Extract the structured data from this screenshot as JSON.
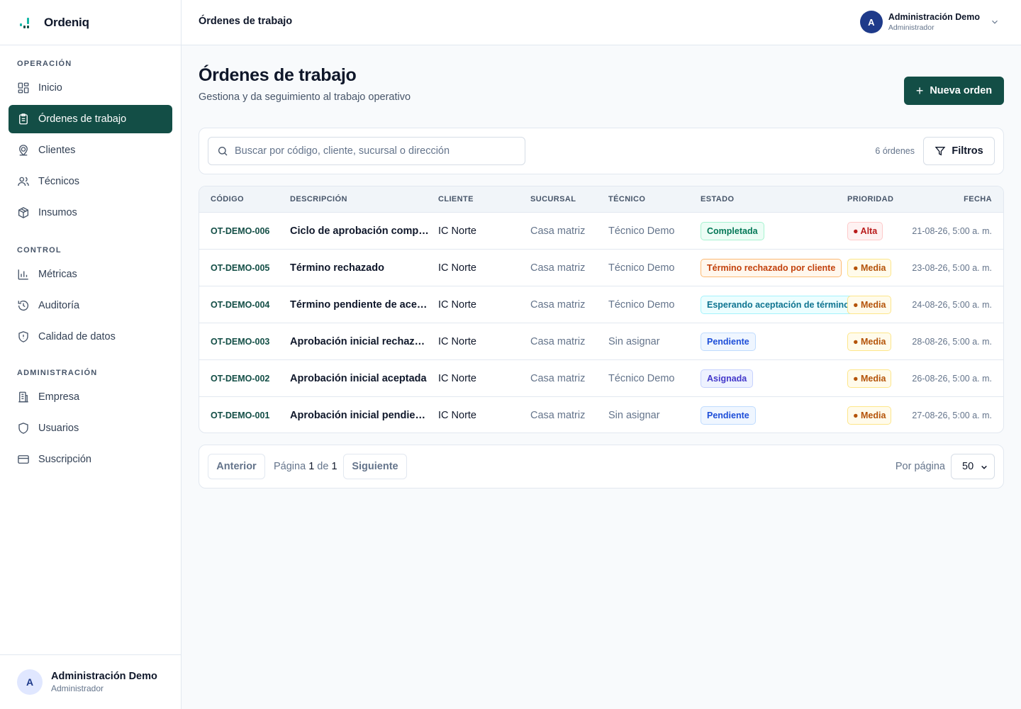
{
  "app": {
    "name": "Ordeniq",
    "accent": "#134e46"
  },
  "sidebar": {
    "sections": [
      {
        "title": "OPERACIÓN",
        "items": [
          {
            "label": "Inicio",
            "icon": "dashboard-icon"
          },
          {
            "label": "Órdenes de trabajo",
            "icon": "clipboard-icon",
            "active": true
          },
          {
            "label": "Clientes",
            "icon": "map-pin-icon"
          },
          {
            "label": "Técnicos",
            "icon": "users-icon"
          },
          {
            "label": "Insumos",
            "icon": "package-icon"
          }
        ]
      },
      {
        "title": "CONTROL",
        "items": [
          {
            "label": "Métricas",
            "icon": "bar-chart-icon"
          },
          {
            "label": "Auditoría",
            "icon": "history-icon"
          },
          {
            "label": "Calidad de datos",
            "icon": "shield-alert-icon"
          }
        ]
      },
      {
        "title": "ADMINISTRACIÓN",
        "items": [
          {
            "label": "Empresa",
            "icon": "building-icon"
          },
          {
            "label": "Usuarios",
            "icon": "shield-icon"
          },
          {
            "label": "Suscripción",
            "icon": "credit-card-icon"
          }
        ]
      }
    ],
    "user": {
      "initial": "A",
      "name": "Administración Demo",
      "role": "Administrador"
    }
  },
  "topbar": {
    "title": "Órdenes de trabajo",
    "user": {
      "initial": "A",
      "name": "Administración Demo",
      "role": "Administrador"
    }
  },
  "page": {
    "title": "Órdenes de trabajo",
    "subtitle": "Gestiona y da seguimiento al trabajo operativo",
    "new_button": "Nueva orden",
    "new_button_icon": "plus-icon"
  },
  "filters": {
    "search_placeholder": "Buscar por código, cliente, sucursal o dirección",
    "count": "6 órdenes",
    "filter_button": "Filtros"
  },
  "table": {
    "columns": [
      "CÓDIGO",
      "DESCRIPCIÓN",
      "CLIENTE",
      "SUCURSAL",
      "TÉCNICO",
      "ESTADO",
      "PRIORIDAD",
      "FECHA"
    ],
    "rows": [
      {
        "code": "OT-DEMO-006",
        "description": "Ciclo de aprobación compl…",
        "client": "IC Norte",
        "branch": "Casa matriz",
        "tech": "Técnico Demo",
        "status": "Completada",
        "status_tone": "green",
        "priority": "● Alta",
        "priority_tone": "red",
        "date": "21-08-26, 5:00 a. m."
      },
      {
        "code": "OT-DEMO-005",
        "description": "Término rechazado",
        "client": "IC Norte",
        "branch": "Casa matriz",
        "tech": "Técnico Demo",
        "status": "Término rechazado por cliente",
        "status_tone": "orange",
        "priority": "● Media",
        "priority_tone": "amber",
        "date": "23-08-26, 5:00 a. m."
      },
      {
        "code": "OT-DEMO-004",
        "description": "Término pendiente de acep…",
        "client": "IC Norte",
        "branch": "Casa matriz",
        "tech": "Técnico Demo",
        "status": "Esperando aceptación de término",
        "status_tone": "cyan",
        "priority": "● Media",
        "priority_tone": "amber",
        "date": "24-08-26, 5:00 a. m."
      },
      {
        "code": "OT-DEMO-003",
        "description": "Aprobación inicial rechazada",
        "client": "IC Norte",
        "branch": "Casa matriz",
        "tech": "Sin asignar",
        "status": "Pendiente",
        "status_tone": "blue",
        "priority": "● Media",
        "priority_tone": "amber",
        "date": "28-08-26, 5:00 a. m."
      },
      {
        "code": "OT-DEMO-002",
        "description": "Aprobación inicial aceptada",
        "client": "IC Norte",
        "branch": "Casa matriz",
        "tech": "Técnico Demo",
        "status": "Asignada",
        "status_tone": "indigo",
        "priority": "● Media",
        "priority_tone": "amber",
        "date": "26-08-26, 5:00 a. m."
      },
      {
        "code": "OT-DEMO-001",
        "description": "Aprobación inicial pendiente",
        "client": "IC Norte",
        "branch": "Casa matriz",
        "tech": "Sin asignar",
        "status": "Pendiente",
        "status_tone": "blue",
        "priority": "● Media",
        "priority_tone": "amber",
        "date": "27-08-26, 5:00 a. m."
      }
    ]
  },
  "pagination": {
    "prev": "Anterior",
    "next": "Siguiente",
    "page_word": "Página",
    "page": "1",
    "of_word": "de",
    "total": "1",
    "per_page_label": "Por página",
    "per_page": "50"
  },
  "tones": {
    "green": {
      "bg": "#ecfdf5",
      "border": "#a7f3d0",
      "text": "#047857"
    },
    "orange": {
      "bg": "#fff7ed",
      "border": "#fdba74",
      "text": "#c2410c"
    },
    "cyan": {
      "bg": "#ecfeff",
      "border": "#a5f3fc",
      "text": "#0e7490"
    },
    "blue": {
      "bg": "#eff6ff",
      "border": "#bfdbfe",
      "text": "#1d4ed8"
    },
    "indigo": {
      "bg": "#eef2ff",
      "border": "#c7d2fe",
      "text": "#4338ca"
    },
    "red": {
      "bg": "#fef2f2",
      "border": "#fecaca",
      "text": "#b91c1c"
    },
    "amber": {
      "bg": "#fffbeb",
      "border": "#fde68a",
      "text": "#b45309"
    }
  }
}
